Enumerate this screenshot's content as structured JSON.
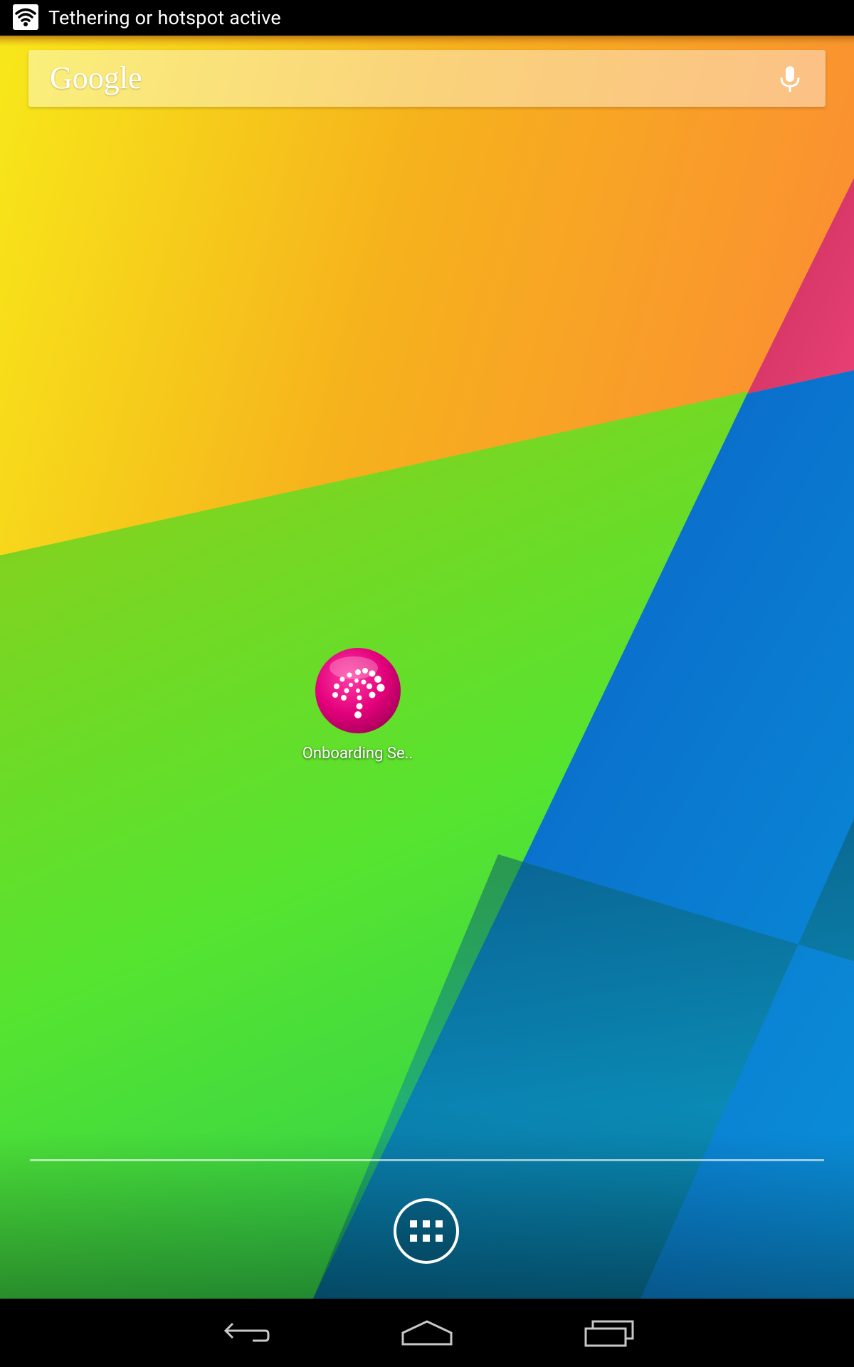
{
  "status_bar": {
    "notification_icon": "hotspot-icon",
    "notification_text": "Tethering or hotspot active"
  },
  "search_bar": {
    "logo_text": "Google",
    "voice_icon": "microphone-icon"
  },
  "home_screen": {
    "apps": [
      {
        "label": "Onboarding Se..",
        "icon": "onboarding-app-icon",
        "icon_color": "#e2007a"
      }
    ]
  },
  "dock": {
    "app_drawer_icon": "app-drawer-icon"
  },
  "nav_bar": {
    "buttons": [
      {
        "name": "back",
        "icon": "back-icon"
      },
      {
        "name": "home",
        "icon": "home-icon"
      },
      {
        "name": "recents",
        "icon": "recents-icon"
      }
    ]
  },
  "colors": {
    "status_bar_bg": "#000000",
    "nav_bar_bg": "#000000",
    "wallpaper_yellow": "#f3e400",
    "wallpaper_orange": "#fb8b2a",
    "wallpaper_green": "#5ae42c",
    "wallpaper_blue": "#0a7ad4",
    "wallpaper_pink": "#e7356e"
  }
}
